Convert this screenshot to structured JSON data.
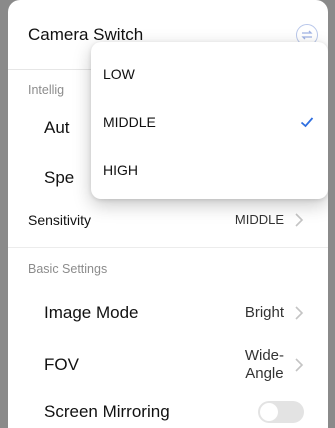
{
  "header": {
    "title": "Camera Switch",
    "icon": "toggle-arrows-icon"
  },
  "sections": {
    "intelligent_label": "Intellig",
    "basic_label": "Basic Settings"
  },
  "hidden_rows": {
    "row1_label": "Aut",
    "row2_label": "Spe"
  },
  "sensitivity": {
    "label": "Sensitivity",
    "value": "MIDDLE"
  },
  "image_mode": {
    "label": "Image Mode",
    "value": "Bright"
  },
  "fov": {
    "label": "FOV",
    "value_line1": "Wide-",
    "value_line2": "Angle"
  },
  "screen_mirroring": {
    "label": "Screen Mirroring",
    "enabled": false
  },
  "dropdown": {
    "options": [
      "LOW",
      "MIDDLE",
      "HIGH"
    ],
    "selected": "MIDDLE",
    "check_color": "#2f6fe0"
  }
}
